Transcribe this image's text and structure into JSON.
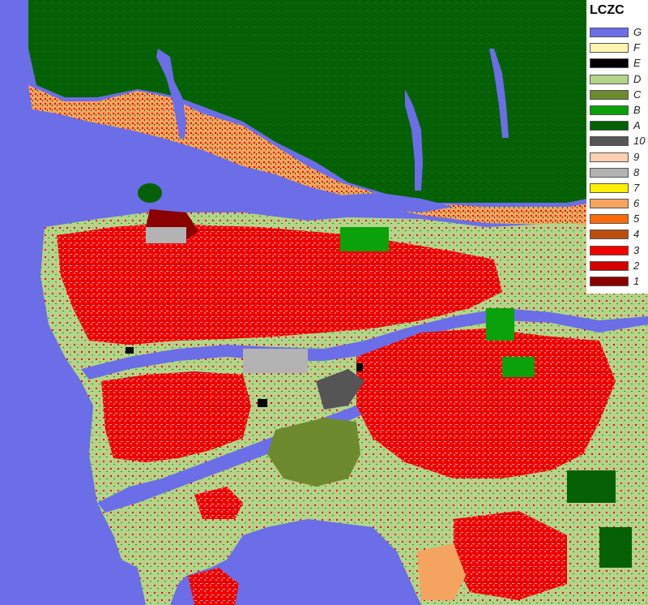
{
  "legend": {
    "title": "LCZC",
    "items": [
      {
        "label": "G",
        "color": "#6b6ee6"
      },
      {
        "label": "F",
        "color": "#fdf3b0"
      },
      {
        "label": "E",
        "color": "#000000"
      },
      {
        "label": "D",
        "color": "#b4d48a"
      },
      {
        "label": "C",
        "color": "#6e8a2e"
      },
      {
        "label": "B",
        "color": "#0aa10a"
      },
      {
        "label": "A",
        "color": "#066106"
      },
      {
        "label": "10",
        "color": "#555555"
      },
      {
        "label": "9",
        "color": "#fccfb1"
      },
      {
        "label": "8",
        "color": "#b3b3b3"
      },
      {
        "label": "7",
        "color": "#fef000"
      },
      {
        "label": "6",
        "color": "#f4a460"
      },
      {
        "label": "5",
        "color": "#fb6b0a"
      },
      {
        "label": "4",
        "color": "#bb4e0f"
      },
      {
        "label": "3",
        "color": "#f20000"
      },
      {
        "label": "2",
        "color": "#d40000"
      },
      {
        "label": "1",
        "color": "#8b0000"
      }
    ]
  }
}
